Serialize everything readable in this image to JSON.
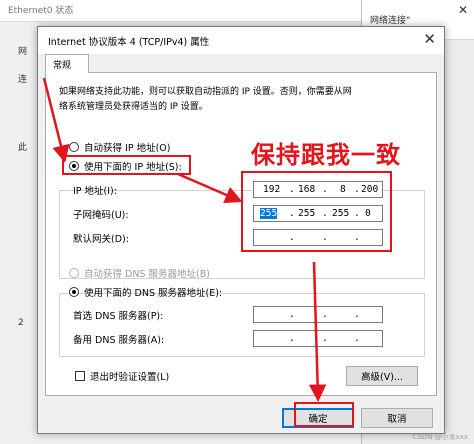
{
  "background": {
    "window1_title": "Ethernet0 状态",
    "window2_title": "网络连接\"",
    "side_labels": [
      "网",
      "连",
      "此",
      "2"
    ]
  },
  "dialog": {
    "title": "Internet 协议版本 4 (TCP/IPv4) 属性",
    "tab_label": "常规",
    "intro_line1": "如果网络支持此功能，则可以获取自动指派的 IP 设置。否则，你需要从网",
    "intro_line2": "络系统管理员处获得适当的 IP 设置。",
    "ip_section": {
      "auto_radio": "自动获得 IP 地址(O)",
      "manual_radio": "使用下面的 IP 地址(S):",
      "ip_label": "IP 地址(I):",
      "mask_label": "子网掩码(U):",
      "gateway_label": "默认网关(D):",
      "ip_value": [
        "192",
        "168",
        "8",
        "200"
      ],
      "mask_value": [
        "255",
        "255",
        "255",
        "0"
      ],
      "gateway_value": [
        "",
        "",
        "",
        ""
      ]
    },
    "dns_section": {
      "auto_radio": "自动获得 DNS 服务器地址(B)",
      "manual_radio": "使用下面的 DNS 服务器地址(E):",
      "preferred_label": "首选 DNS 服务器(P):",
      "alternate_label": "备用 DNS 服务器(A):",
      "preferred_value": [
        "",
        "",
        "",
        ""
      ],
      "alternate_value": [
        "",
        "",
        "",
        ""
      ]
    },
    "validate_checkbox": "退出时验证设置(L)",
    "advanced_button": "高级(V)...",
    "ok_button": "确定",
    "cancel_button": "取消"
  },
  "annotation": {
    "text": "保持跟我一致",
    "color": "#e3141b"
  },
  "watermark": "CSDN @小龙xxx"
}
